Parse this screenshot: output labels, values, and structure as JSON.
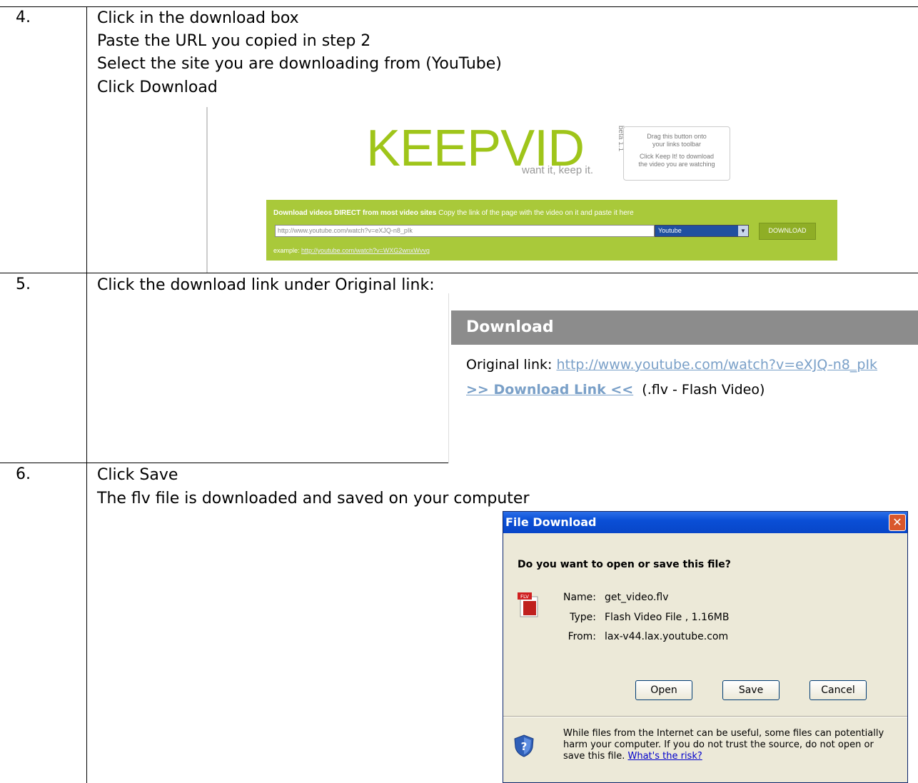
{
  "rows": [
    {
      "number": "4.",
      "lines": [
        "Click in the download box",
        "Paste the URL you copied in step 2",
        "Select the site you are downloading from (YouTube)",
        "Click Download"
      ]
    },
    {
      "number": "5.",
      "lines": [
        "Click the download link under Original link:"
      ]
    },
    {
      "number": "6.",
      "lines": [
        "Click Save",
        "The flv file is downloaded and saved on your computer"
      ]
    }
  ],
  "keepvid": {
    "logo": "KEEPVID",
    "beta": "beta 1.1",
    "tagline": "want it, keep it.",
    "bookmarklet_l1": "Drag this button onto",
    "bookmarklet_l2": "your links toolbar",
    "bookmarklet_l3": "Click Keep It! to download",
    "bookmarklet_l4": "the video you are watching",
    "panel_title": "Download videos DIRECT from most video sites",
    "panel_hint": "Copy the link of the page with the video on it and paste it here",
    "url_value": "http://www.youtube.com/watch?v=eXJQ-n8_pIk",
    "site_selected": "Youtube",
    "download_button": "DOWNLOAD",
    "example_label": "example:",
    "example_link": "http://youtube.com/watch?v=WXG2wnxWvvg"
  },
  "download_panel": {
    "heading": "Download",
    "original_label": "Original link:",
    "original_url": "http://www.youtube.com/watch?v=eXJQ-n8_pIk",
    "download_link": ">> Download Link <<",
    "format": "(.flv - Flash Video)"
  },
  "dialog": {
    "title": "File Download",
    "question": "Do you want to open or save this file?",
    "name_label": "Name:",
    "name_value": "get_video.flv",
    "type_label": "Type:",
    "type_value": "Flash Video File , 1.16MB",
    "from_label": "From:",
    "from_value": "lax-v44.lax.youtube.com",
    "open_button": "Open",
    "save_button": "Save",
    "cancel_button": "Cancel",
    "warning_l1": "While files from the Internet can be useful, some files can potentially",
    "warning_l2": "harm your computer. If you do not trust the source, do not open or",
    "warning_l3": "save this file.",
    "risk_link": "What's the risk?",
    "icon_text": "FLV",
    "close_glyph": "✕"
  }
}
